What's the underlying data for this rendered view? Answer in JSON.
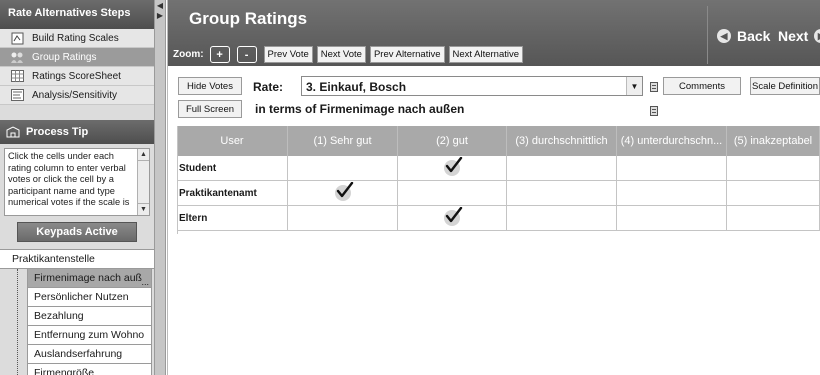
{
  "steps": {
    "header": "Rate Alternatives Steps",
    "items": [
      {
        "label": "Build Rating Scales",
        "icon": "scales-icon",
        "active": false
      },
      {
        "label": "Group Ratings",
        "icon": "group-ratings-icon",
        "active": true
      },
      {
        "label": "Ratings ScoreSheet",
        "icon": "scoresheet-icon",
        "active": false
      },
      {
        "label": "Analysis/Sensitivity",
        "icon": "analysis-icon",
        "active": false
      }
    ]
  },
  "process_tip": {
    "header": "Process Tip",
    "text": "Click the cells under each rating column to enter verbal votes or click the cell by a participant name and type numerical votes if the scale is"
  },
  "keypads": {
    "label": "Keypads Active"
  },
  "tree": {
    "root": "Praktikantenstelle",
    "items": [
      {
        "label": "Firmenimage nach auß",
        "selected": true
      },
      {
        "label": "Persönlicher Nutzen",
        "selected": false
      },
      {
        "label": "Bezahlung",
        "selected": false
      },
      {
        "label": "Entfernung zum Wohno",
        "selected": false
      },
      {
        "label": "Auslandserfahrung",
        "selected": false
      },
      {
        "label": "Firmengröße",
        "selected": false
      }
    ]
  },
  "header": {
    "title": "Group Ratings",
    "back_label": "Back",
    "next_label": "Next"
  },
  "toolbar": {
    "zoom_label": "Zoom:",
    "zoom_in": "+",
    "zoom_out": "-",
    "prev_vote": "Prev Vote",
    "next_vote": "Next Vote",
    "prev_alternative": "Prev Alternative",
    "next_alternative": "Next Alternative"
  },
  "rate": {
    "hide_votes": "Hide Votes",
    "full_screen": "Full Screen",
    "label": "Rate:",
    "selected": "3. Einkauf, Bosch",
    "subtitle": "in terms of Firmenimage nach außen",
    "comments": "Comments",
    "scale_definitions": "Scale Definition"
  },
  "grid": {
    "columns": [
      "User",
      "(1) Sehr gut",
      "(2) gut",
      "(3) durchschnittlich",
      "(4) unterdurchschn...",
      "(5) inakzeptabel"
    ],
    "rows": [
      {
        "user": "Student",
        "vote_column": 2
      },
      {
        "user": "Praktikantenamt",
        "vote_column": 1
      },
      {
        "user": "Eltern",
        "vote_column": 2
      }
    ]
  }
}
